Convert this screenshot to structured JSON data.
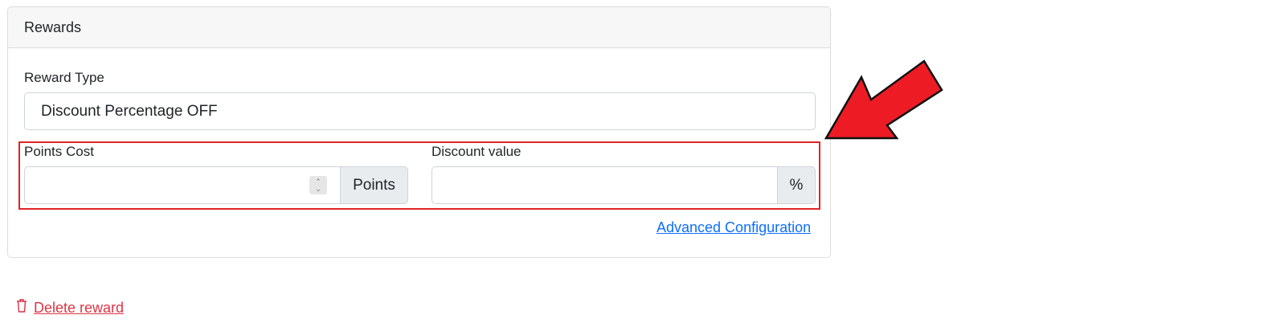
{
  "rewards_card": {
    "title": "Rewards",
    "reward_type": {
      "label": "Reward Type",
      "selected": "Discount Percentage OFF"
    },
    "points_cost": {
      "label": "Points Cost",
      "value": "",
      "addon": "Points"
    },
    "discount_value": {
      "label": "Discount value",
      "value": "",
      "addon": "%"
    },
    "advanced_link": "Advanced Configuration"
  },
  "delete_reward": "Delete reward",
  "annotation": {
    "highlight_color": "#e02424",
    "arrow_color": "#ed1c24",
    "icon": "arrow-pointer-icon"
  }
}
